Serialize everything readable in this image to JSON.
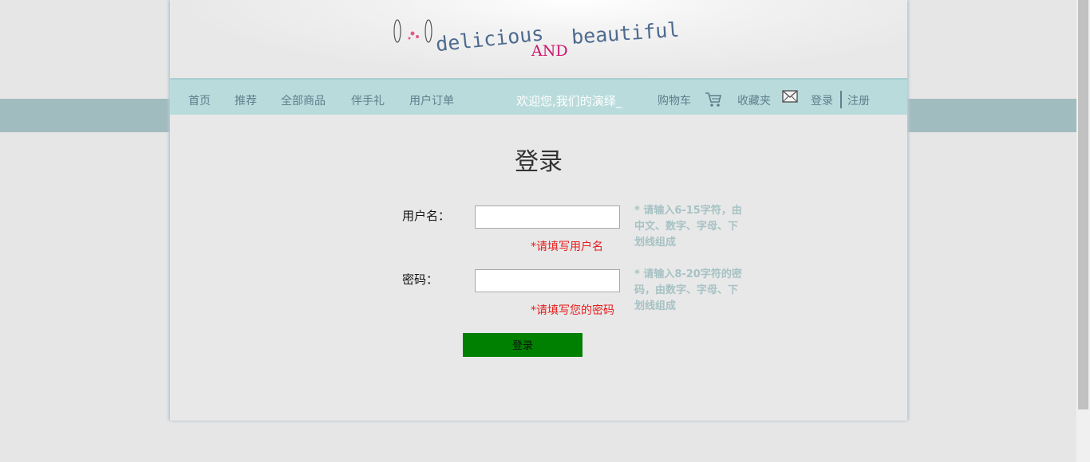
{
  "logo": {
    "text_left": "delicious",
    "text_mid": "AND",
    "text_right": "beautiful"
  },
  "nav": {
    "items": [
      "首页",
      "推荐",
      "全部商品",
      "伴手礼",
      "用户订单"
    ],
    "welcome": "欢迎您,我们的演绎_",
    "cart_label": "购物车",
    "favorites_label": "收藏夹",
    "login_label": "登录",
    "register_label": "注册"
  },
  "form": {
    "title": "登录",
    "username_label": "用户名：",
    "username_value": "",
    "username_error": "*请填写用户名",
    "username_hint": "* 请输入6-15字符，由中文、数字、字母、下划线组成",
    "password_label": "密码：",
    "password_value": "",
    "password_error": "*请填写您的密码",
    "password_hint": "* 请输入8-20字符的密码，由数字、字母、下划线组成",
    "submit_label": "登录"
  },
  "colors": {
    "nav_bg": "#b9dbdc",
    "band": "#a1bcbe",
    "button": "#008000",
    "error": "#e81b1b",
    "hint": "#a7c2c4"
  }
}
